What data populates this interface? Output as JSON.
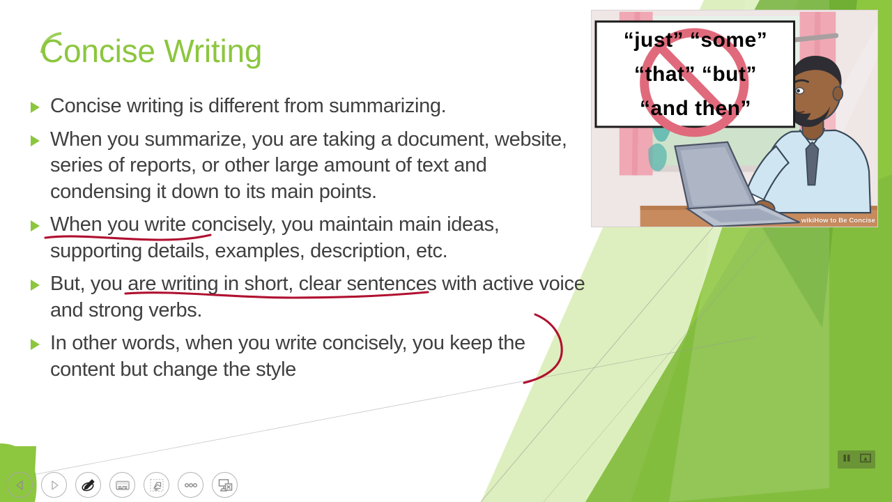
{
  "slide": {
    "title": "Concise Writing",
    "bullets": [
      "Concise writing is different from summarizing.",
      "When you summarize, you are taking a document, website, series of reports, or other large amount of text and condensing it down to its main points.",
      "When you write concisely, you maintain main ideas, supporting details, examples, description, etc.",
      "But, you are writing in short, clear sentences with active voice and strong verbs.",
      "In other words, when you write concisely, you keep the content but change the style"
    ],
    "colors": {
      "title_green": "#8CC63E",
      "bullet_green": "#8CC63E",
      "body_text": "#3f3f3f",
      "ink_red": "#B01030",
      "facet_light": "#DDEFBE",
      "facet_mid": "#9CCB45",
      "facet_bright": "#8DC63F",
      "facet_dark": "#6FAE33"
    },
    "annotations": [
      {
        "name": "underline-its-main-points",
        "type": "ink-underline",
        "color": "#B01030"
      },
      {
        "name": "underline-supporting-details-examples",
        "type": "ink-underline",
        "color": "#B01030"
      },
      {
        "name": "curly-brace-right",
        "type": "ink-curve",
        "color": "#B01030"
      }
    ]
  },
  "picture": {
    "name": "wikihow-be-concise-illustration",
    "sign_lines": [
      "“just”  “some”",
      "“that”  “but”",
      "“and then”"
    ],
    "prohibition_symbol": "no-entry-circle-slash",
    "watermark_wiki": "wiki",
    "watermark_rest": "How to Be Concise",
    "alt": "Man in light blue shirt and tie typing on a laptop with a sign showing crossed-out filler words"
  },
  "show_controls": [
    {
      "name": "previous-slide-button",
      "icon": "chevron-left-icon",
      "label": "Previous"
    },
    {
      "name": "next-slide-button",
      "icon": "chevron-right-icon",
      "label": "Next"
    },
    {
      "name": "pen-tools-button",
      "icon": "pen-slash-icon",
      "label": "Pen and laser pointer tools"
    },
    {
      "name": "subtitles-button",
      "icon": "subtitles-icon",
      "label": "Toggle subtitles"
    },
    {
      "name": "see-all-slides-button",
      "icon": "slide-grid-icon",
      "label": "See all slides"
    },
    {
      "name": "zoom-slide-button",
      "icon": "zoom-slide-icon",
      "label": "Zoom into the slide"
    },
    {
      "name": "more-options-button",
      "icon": "ellipsis-icon",
      "label": "More slide show options"
    },
    {
      "name": "end-show-button",
      "icon": "projector-x-icon",
      "label": "End show"
    }
  ],
  "media_overlay": [
    {
      "name": "pause-button",
      "icon": "pause-icon",
      "label": "Pause"
    },
    {
      "name": "presenter-view-button",
      "icon": "presenter-view-icon",
      "label": "Presenter view"
    }
  ]
}
